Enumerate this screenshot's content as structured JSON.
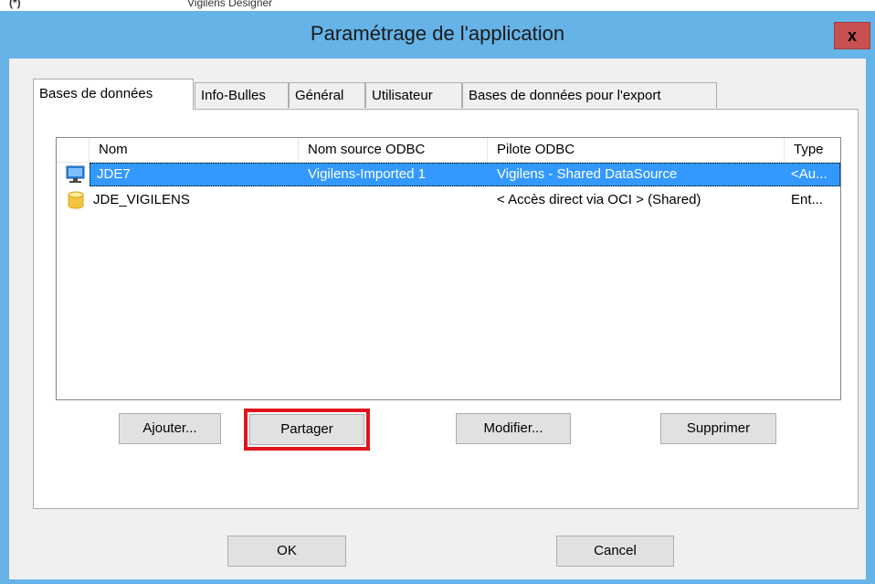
{
  "background_window": {
    "left_fragment": "(*)",
    "title_fragment": "Vigilens Designer"
  },
  "dialog": {
    "title": "Paramétrage de l'application",
    "close_glyph": "x"
  },
  "tabs": [
    {
      "label": "Bases de données",
      "active": true
    },
    {
      "label": "Info-Bulles",
      "active": false
    },
    {
      "label": "Général",
      "active": false
    },
    {
      "label": "Utilisateur",
      "active": false
    },
    {
      "label": "Bases de données pour l'export",
      "active": false
    }
  ],
  "list": {
    "columns": [
      "Nom",
      "Nom source ODBC",
      "Pilote ODBC",
      "Type"
    ],
    "rows": [
      {
        "icon": "monitor-icon",
        "nom": "JDE7",
        "source": "Vigilens-Imported 1",
        "pilote": "Vigilens - Shared DataSource",
        "type": "<Au...",
        "selected": true
      },
      {
        "icon": "database-icon",
        "nom": "JDE_VIGILENS",
        "source": "",
        "pilote": "< Accès direct via OCI > (Shared)",
        "type": "Ent...",
        "selected": false
      }
    ]
  },
  "buttons": {
    "add": "Ajouter...",
    "share": "Partager",
    "modify": "Modifier...",
    "delete": "Supprimer",
    "ok": "OK",
    "cancel": "Cancel"
  },
  "colors": {
    "title_bar": "#66b3e8",
    "selection": "#3399ff",
    "highlight": "#e0141c",
    "close_button": "#c75050"
  }
}
